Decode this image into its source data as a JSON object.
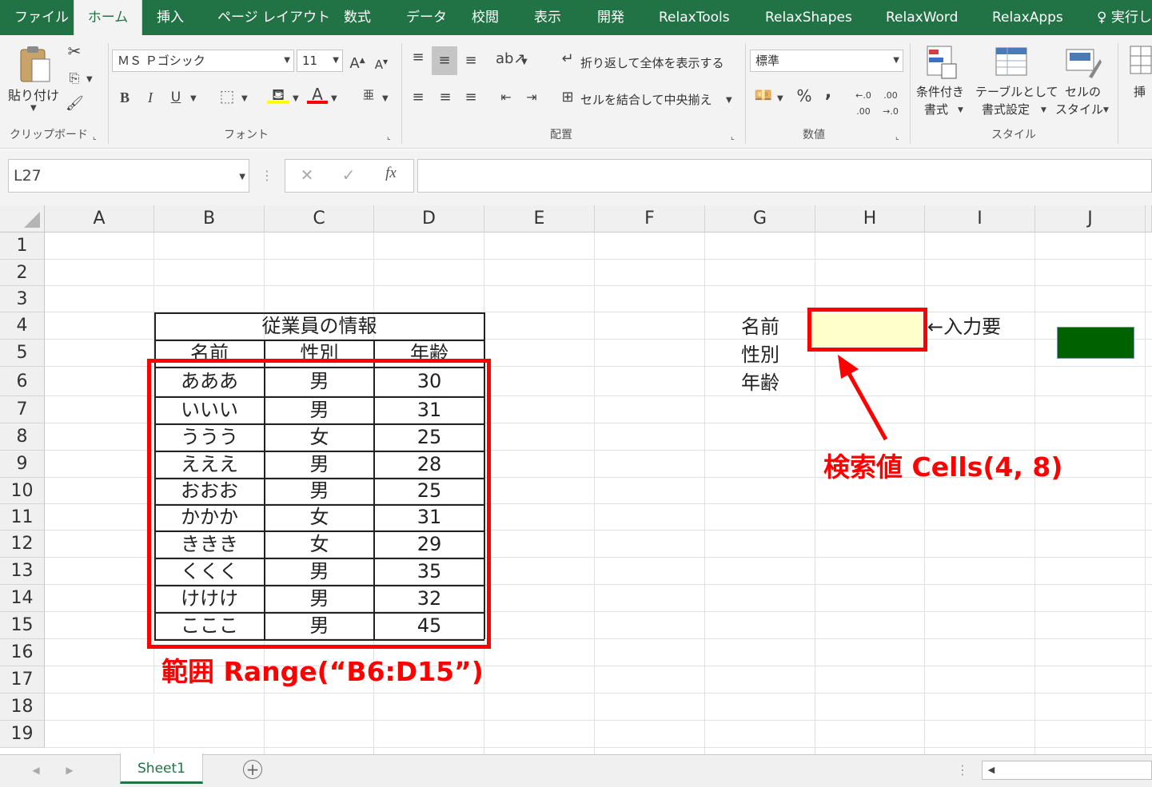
{
  "tabs": [
    "ファイル",
    "ホーム",
    "挿入",
    "ページ レイアウト",
    "数式",
    "データ",
    "校閲",
    "表示",
    "開発",
    "RelaxTools",
    "RelaxShapes",
    "RelaxWord",
    "RelaxApps",
    "実行し"
  ],
  "active_tab": "ホーム",
  "ribbon": {
    "paste_label": "貼り付け",
    "font_name": "ＭＳ Ｐゴシック",
    "font_size": "11",
    "wrap_text": "折り返して全体を表示する",
    "merge_center": "セルを結合して中央揃え",
    "number_format": "標準",
    "cond_format_l1": "条件付き",
    "cond_format_l2": "書式",
    "table_format_l1": "テーブルとして",
    "table_format_l2": "書式設定",
    "cell_style_l1": "セルの",
    "cell_style_l2": "スタイル",
    "insert_label": "挿",
    "groups": {
      "clipboard": "クリップボード",
      "font": "フォント",
      "alignment": "配置",
      "number": "数値",
      "styles": "スタイル"
    },
    "bold": "B",
    "italic": "I",
    "underline": "U",
    "font_color_letter": "A",
    "percent": "%",
    "comma": ","
  },
  "name_box": "L27",
  "fx_label": "fx",
  "columns": [
    "A",
    "B",
    "C",
    "D",
    "E",
    "F",
    "G",
    "H",
    "I",
    "J"
  ],
  "rows": [
    "1",
    "2",
    "3",
    "4",
    "5",
    "6",
    "7",
    "8",
    "9",
    "10",
    "11",
    "12",
    "13",
    "14",
    "15",
    "16",
    "17",
    "18",
    "19"
  ],
  "table": {
    "title": "従業員の情報",
    "headers": [
      "名前",
      "性別",
      "年齢"
    ],
    "rows": [
      [
        "あああ",
        "男",
        "30"
      ],
      [
        "いいい",
        "男",
        "31"
      ],
      [
        "ううう",
        "女",
        "25"
      ],
      [
        "えええ",
        "男",
        "28"
      ],
      [
        "おおお",
        "男",
        "25"
      ],
      [
        "かかか",
        "女",
        "31"
      ],
      [
        "ききき",
        "女",
        "29"
      ],
      [
        "くくく",
        "男",
        "35"
      ],
      [
        "けけけ",
        "男",
        "32"
      ],
      [
        "こここ",
        "男",
        "45"
      ]
    ]
  },
  "lookup": {
    "label_name": "名前",
    "label_gender": "性別",
    "label_age": "年齢",
    "input_note": "←入力要",
    "input_fill": "#ffffcc"
  },
  "annotations": {
    "range": "範囲 Range(“B6:D15”)",
    "search": "検索値 Cells(4, 8)",
    "color": "#ff0000"
  },
  "green_box_color": "#006100",
  "sheet_tab": "Sheet1",
  "colors": {
    "accent": "#217346"
  }
}
